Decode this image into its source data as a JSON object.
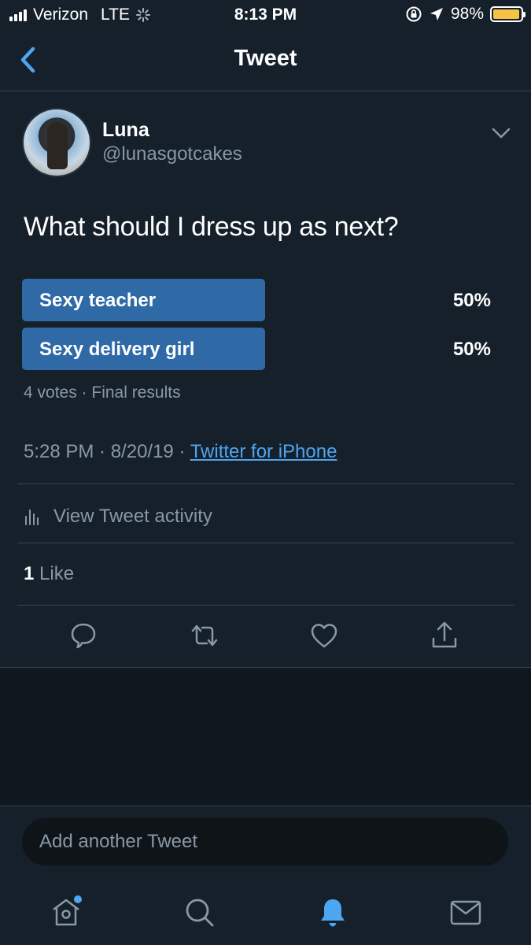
{
  "status_bar": {
    "carrier": "Verizon",
    "network": "LTE",
    "time": "8:13 PM",
    "battery": "98%",
    "battery_level": 0.98
  },
  "nav": {
    "title": "Tweet",
    "back_icon": "chevron-left-icon"
  },
  "tweet": {
    "author_name": "Luna",
    "author_handle": "@lunasgotcakes",
    "text": "What should I dress up as next?",
    "poll": {
      "options": [
        {
          "label": "Sexy teacher",
          "percent_label": "50%",
          "fraction": 0.5
        },
        {
          "label": "Sexy delivery girl",
          "percent_label": "50%",
          "fraction": 0.5
        }
      ],
      "meta": "4 votes · Final results"
    },
    "timestamp": "5:28 PM · 8/20/19 · ",
    "source": "Twitter for iPhone",
    "activity_label": "View Tweet activity",
    "like_count": "1",
    "like_label": " Like"
  },
  "composer": {
    "placeholder": "Add another Tweet"
  },
  "colors": {
    "background": "#15202b",
    "accent": "#4ea5f0",
    "poll_bar": "#2f6aa6",
    "muted_text": "#8899a6"
  }
}
